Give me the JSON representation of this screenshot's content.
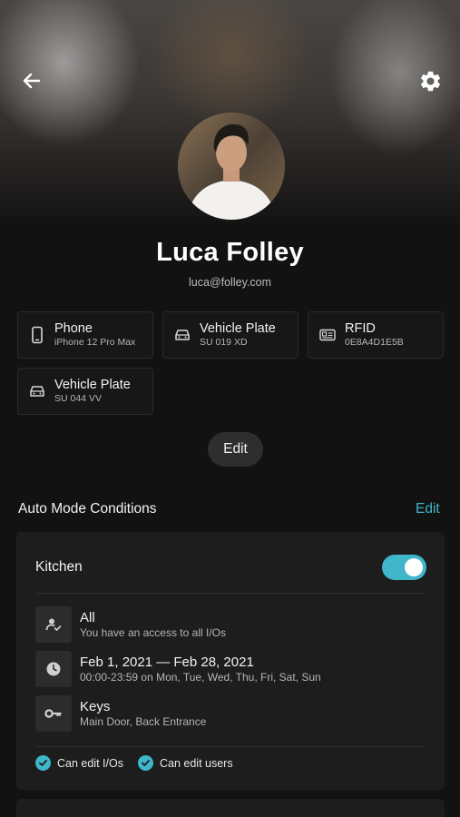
{
  "header": {
    "back_icon": "arrow-left-icon",
    "settings_icon": "gear-icon"
  },
  "profile": {
    "name": "Luca Folley",
    "email": "luca@folley.com",
    "avatar": "profile-photo"
  },
  "credentials": [
    {
      "icon": "phone-icon",
      "title": "Phone",
      "subtitle": "iPhone 12 Pro Max"
    },
    {
      "icon": "car-icon",
      "title": "Vehicle Plate",
      "subtitle": "SU 019 XD"
    },
    {
      "icon": "id-card-icon",
      "title": "RFID",
      "subtitle": "0E8A4D1E5B"
    },
    {
      "icon": "car-icon",
      "title": "Vehicle Plate",
      "subtitle": "SU 044 VV"
    }
  ],
  "edit_label": "Edit",
  "auto_mode": {
    "title": "Auto Mode Conditions",
    "edit_label": "Edit",
    "card": {
      "title": "Kitchen",
      "enabled": true,
      "accent": "#3fb6c9",
      "rows": [
        {
          "icon": "user-check-icon",
          "title": "All",
          "subtitle": "You have an access to all I/Os"
        },
        {
          "icon": "clock-icon",
          "title": "Feb 1, 2021 — Feb 28, 2021",
          "subtitle": "00:00-23:59 on Mon, Tue, Wed, Thu, Fri, Sat, Sun"
        },
        {
          "icon": "key-icon",
          "title": "Keys",
          "subtitle": "Main Door, Back Entrance"
        }
      ],
      "permissions": [
        "Can edit I/Os",
        "Can edit users"
      ]
    }
  }
}
